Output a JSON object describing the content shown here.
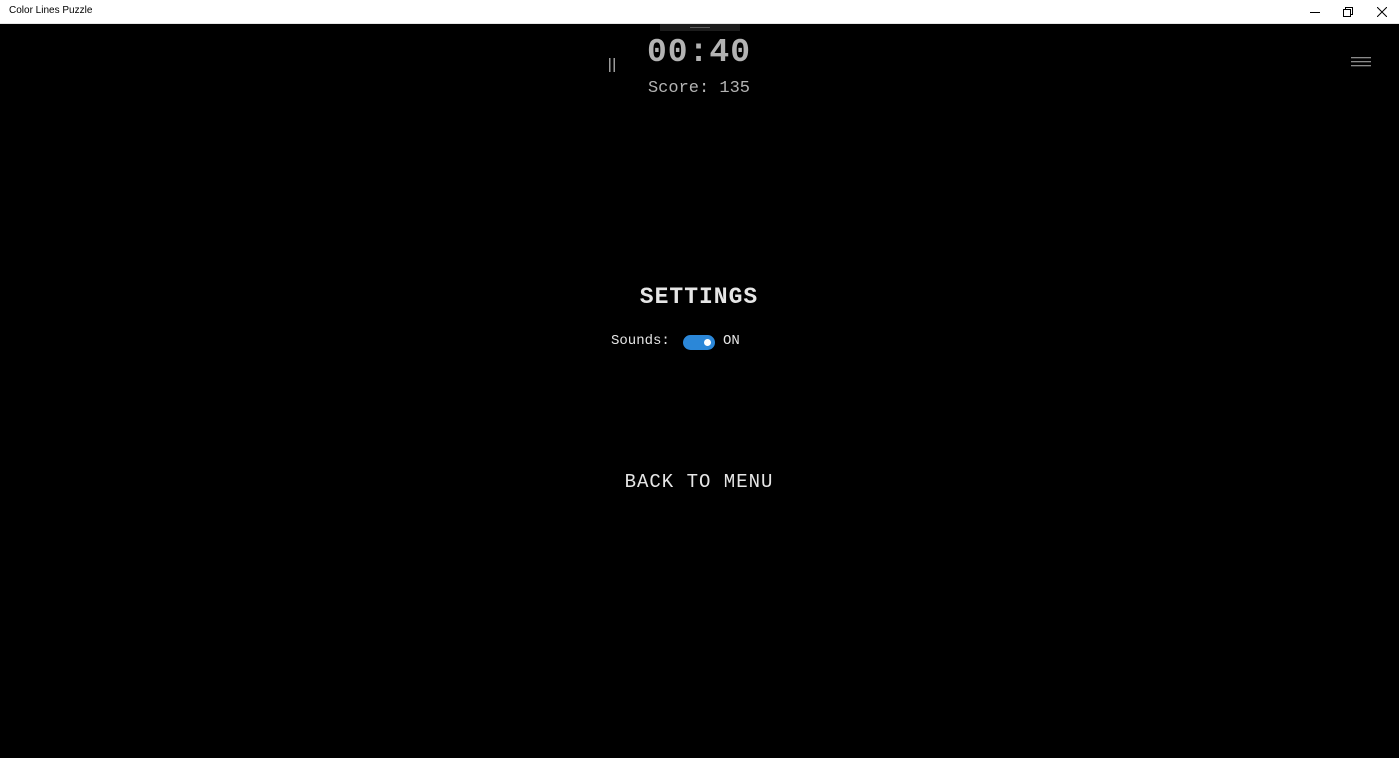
{
  "window": {
    "title": "Color Lines Puzzle",
    "controls": {
      "minimize_icon": "minimize-icon",
      "maximize_icon": "restore-icon",
      "close_icon": "close-icon"
    }
  },
  "hud": {
    "timer": "00:40",
    "score_label": "Score:",
    "score_value": "135",
    "pause_icon": "pause-icon",
    "menu_icon": "hamburger-menu-icon"
  },
  "settings": {
    "title": "SETTINGS",
    "sounds_label": "Sounds:",
    "sounds_enabled": true,
    "sounds_state": "ON",
    "back_label": "BACK TO MENU"
  },
  "colors": {
    "background": "#000000",
    "text": "#e6e6e6",
    "hud_text": "#b3b3b3",
    "toggle_on": "#2b87d8"
  }
}
